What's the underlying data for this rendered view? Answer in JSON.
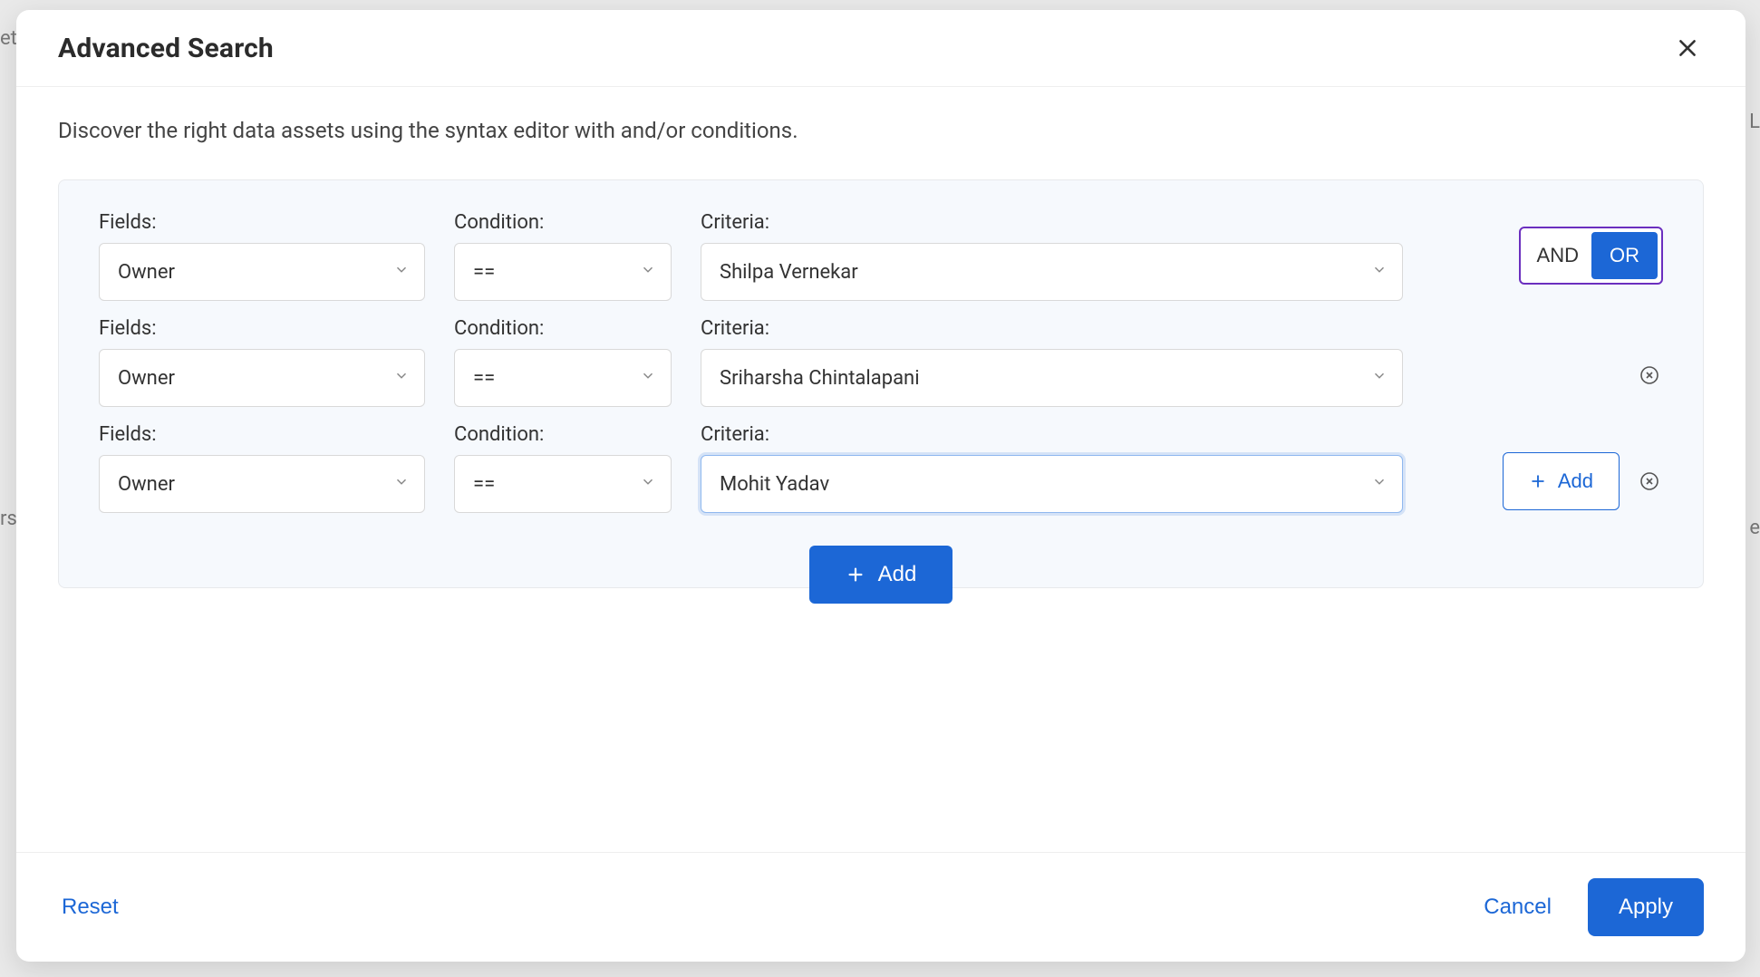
{
  "modal": {
    "title": "Advanced Search",
    "subtitle": "Discover the right data assets using the syntax editor with and/or conditions."
  },
  "labels": {
    "fields": "Fields:",
    "condition": "Condition:",
    "criteria": "Criteria:"
  },
  "logic": {
    "and": "AND",
    "or": "OR",
    "active": "OR"
  },
  "rows": [
    {
      "field": "Owner",
      "condition": "==",
      "criteria": "Shilpa Vernekar",
      "focused": false
    },
    {
      "field": "Owner",
      "condition": "==",
      "criteria": "Sriharsha Chintalapani",
      "focused": false
    },
    {
      "field": "Owner",
      "condition": "==",
      "criteria": "Mohit Yadav",
      "focused": true
    }
  ],
  "buttons": {
    "add_inline": "Add",
    "add_primary": "Add",
    "reset": "Reset",
    "cancel": "Cancel",
    "apply": "Apply"
  }
}
